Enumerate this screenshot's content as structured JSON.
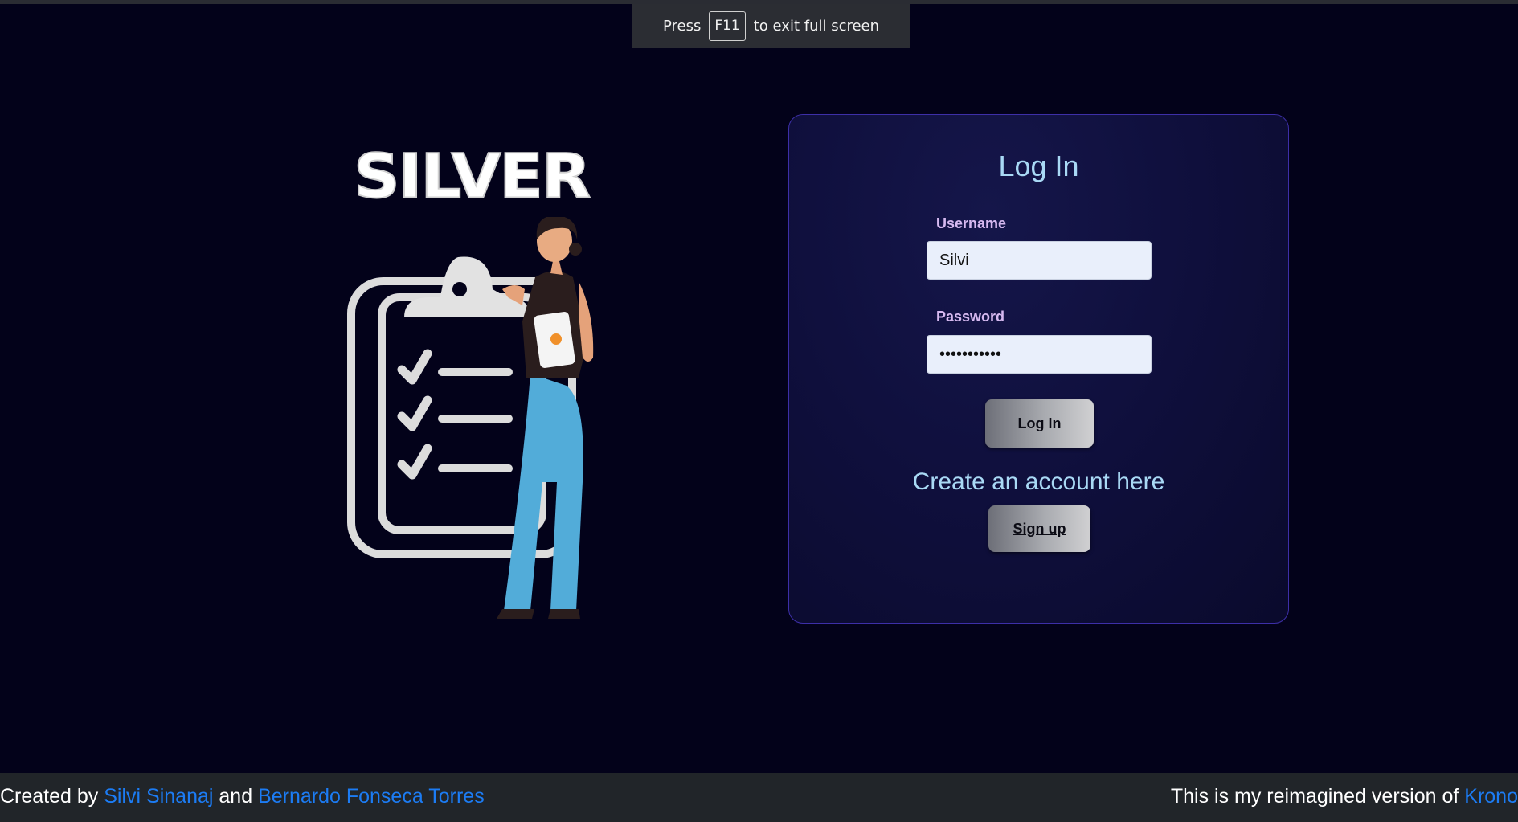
{
  "fullscreen_banner": {
    "press": "Press",
    "key": "F11",
    "suffix": "to exit full screen"
  },
  "brand": {
    "name": "SILVER"
  },
  "illustration": {
    "icon": "clipboard-checklist-icon",
    "figure": "person-with-tablet-illustration"
  },
  "login": {
    "title": "Log In",
    "username_label": "Username",
    "username_value": "Silvi",
    "password_label": "Password",
    "password_value": "•••••••••••",
    "login_button": "Log In",
    "create_text": "Create an account here",
    "signup_button": "Sign up"
  },
  "footer": {
    "created_by": "Created by",
    "author1": "Silvi Sinanaj",
    "and": "and",
    "author2": "Bernardo Fonseca Torres",
    "reimagined": "This is my reimagined version of",
    "link": "Krono"
  },
  "colors": {
    "background": "#03021a",
    "card_border": "#3d2fa8",
    "title": "#a9d9f5",
    "label": "#d6b9f0",
    "link": "#1c7cf4",
    "footer_bg": "#212529"
  }
}
